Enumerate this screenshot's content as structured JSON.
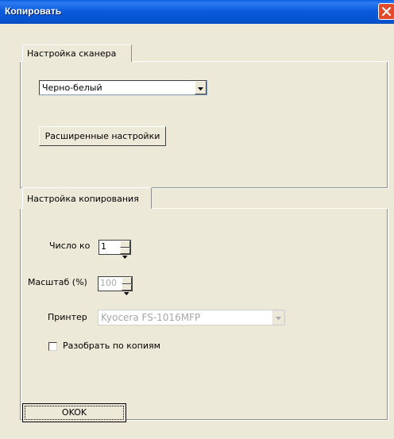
{
  "window": {
    "title": "Копировать"
  },
  "scanner": {
    "tab_label": "Настройка сканера",
    "color_mode": "Черно-белый",
    "advanced_button": "Расширенные настройки"
  },
  "copy": {
    "tab_label": "Настройка копирования",
    "copies_label": "Число ко",
    "copies_value": "1",
    "scale_label": "Масштаб (%)",
    "scale_value": "100",
    "printer_label": "Принтер",
    "printer_value": "Kyocera FS-1016MFP",
    "collate_label": "Разобрать по копиям",
    "collate_checked": false
  },
  "footer": {
    "ok_label": "OKOK"
  }
}
